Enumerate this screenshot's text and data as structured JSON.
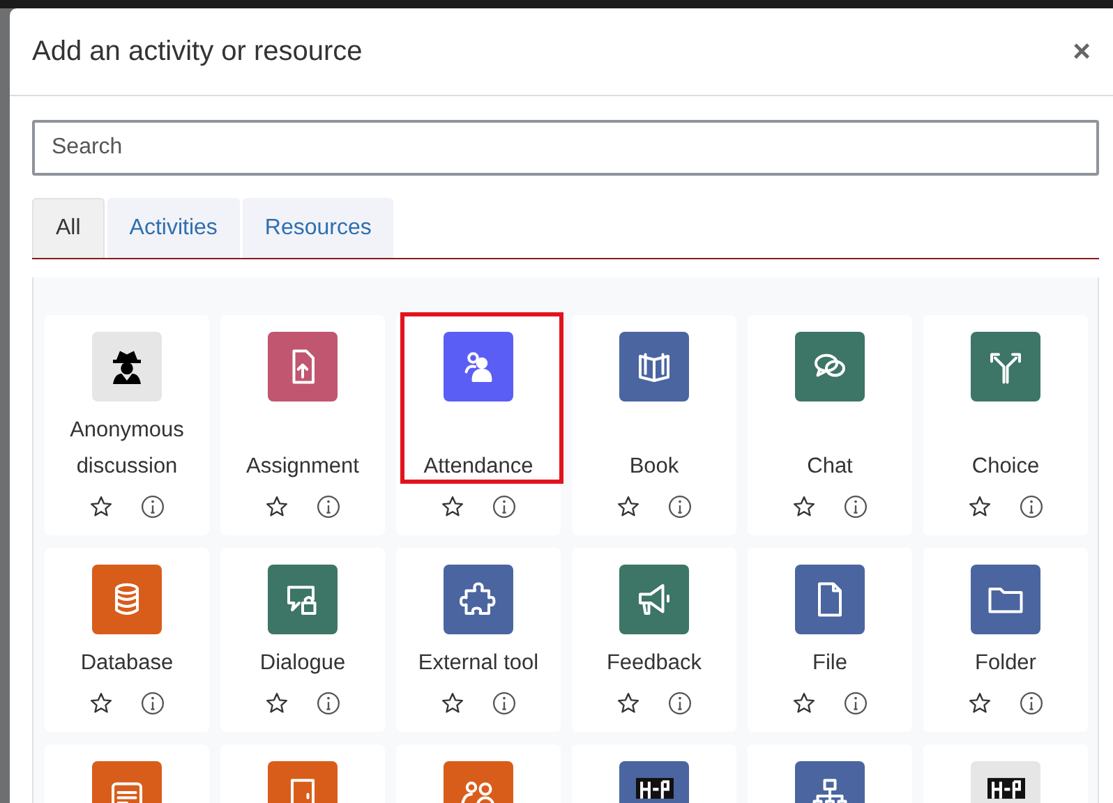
{
  "dialog": {
    "title": "Add an activity or resource",
    "close": "×"
  },
  "search": {
    "placeholder": "Search"
  },
  "tabs": [
    {
      "label": "All",
      "selected": true
    },
    {
      "label": "Activities",
      "selected": false
    },
    {
      "label": "Resources",
      "selected": false
    }
  ],
  "items": [
    {
      "label": "Anonymous discussion",
      "kind": "spy",
      "color": "#e6e6e6",
      "highlighted": false
    },
    {
      "label": "Assignment",
      "kind": "upload",
      "color": "#c0566f",
      "highlighted": false
    },
    {
      "label": "Attendance",
      "kind": "people",
      "color": "#5b5ef5",
      "highlighted": true
    },
    {
      "label": "Book",
      "kind": "book",
      "color": "#4a65a0",
      "highlighted": false
    },
    {
      "label": "Chat",
      "kind": "chat",
      "color": "#3d7567",
      "highlighted": false
    },
    {
      "label": "Choice",
      "kind": "fork",
      "color": "#3d7567",
      "highlighted": false
    },
    {
      "label": "Database",
      "kind": "database",
      "color": "#d95d1a",
      "highlighted": false
    },
    {
      "label": "Dialogue",
      "kind": "lockchat",
      "color": "#3d7567",
      "highlighted": false
    },
    {
      "label": "External tool",
      "kind": "puzzle",
      "color": "#4a65a0",
      "highlighted": false
    },
    {
      "label": "Feedback",
      "kind": "megaphone",
      "color": "#3d7567",
      "highlighted": false
    },
    {
      "label": "File",
      "kind": "file",
      "color": "#4a65a0",
      "highlighted": false
    },
    {
      "label": "Folder",
      "kind": "folder",
      "color": "#4a65a0",
      "highlighted": false
    },
    {
      "kind": "form",
      "color": "#d95d1a",
      "highlighted": false
    },
    {
      "kind": "door",
      "color": "#d95d1a",
      "highlighted": false
    },
    {
      "kind": "group",
      "color": "#d95d1a",
      "highlighted": false
    },
    {
      "kind": "logo",
      "color": "#4a65a0",
      "highlighted": false
    },
    {
      "kind": "network",
      "color": "#4a65a0",
      "highlighted": false
    },
    {
      "kind": "logo",
      "color": "#e6e6e6",
      "highlighted": false
    }
  ]
}
